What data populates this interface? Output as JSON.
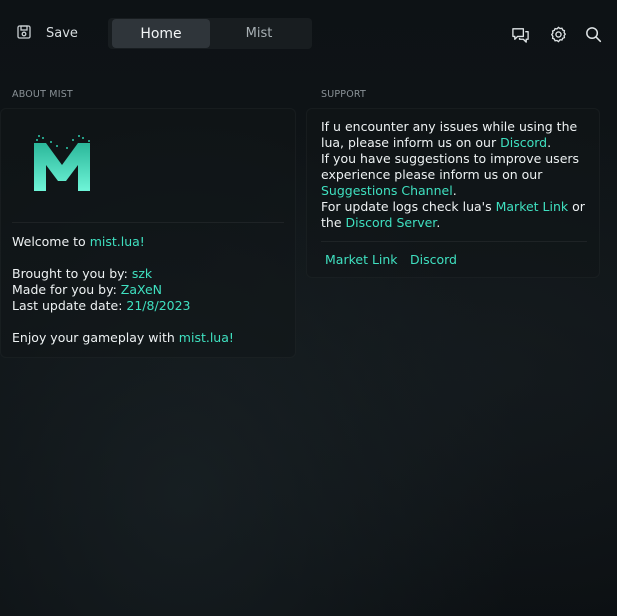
{
  "toolbar": {
    "save_label": "Save",
    "icons": [
      "save-icon",
      "chat-icon",
      "gear-icon",
      "search-icon"
    ]
  },
  "tabs": [
    {
      "label": "Home",
      "active": true
    },
    {
      "label": "Mist",
      "active": false
    }
  ],
  "about": {
    "title": "ABOUT MIST",
    "logo_letter": "M",
    "welcome_prefix": "Welcome to ",
    "welcome_link": "mist.lua!",
    "brought_prefix": "Brought to you by: ",
    "brought_value": "szk",
    "made_prefix": "Made for you by: ",
    "made_value": "ZaXeN",
    "update_prefix": "Last update date: ",
    "update_value": "21/8/2023",
    "enjoy_prefix": "Enjoy your gameplay with ",
    "enjoy_link": "mist.lua!"
  },
  "support": {
    "title": "SUPPORT",
    "line1a": "If u encounter any issues while using the",
    "line1b_prefix": "lua, please inform us on our ",
    "line1b_link": "Discord",
    "line1b_suffix": ".",
    "line2a": "If you have suggestions to improve users",
    "line2b": "experience please inform us on our",
    "line2c_link": "Suggestions Channel",
    "line2c_suffix": ".",
    "line3_prefix": "For update logs check lua's ",
    "line3_link": "Market Link",
    "line3_suffix": " or",
    "line4_prefix": "the ",
    "line4_link": "Discord Server",
    "line4_suffix": ".",
    "button_market": "Market Link",
    "button_discord": "Discord"
  },
  "colors": {
    "accent": "#3fe0c0",
    "background": "#0f1417",
    "panel": "#13181b"
  }
}
